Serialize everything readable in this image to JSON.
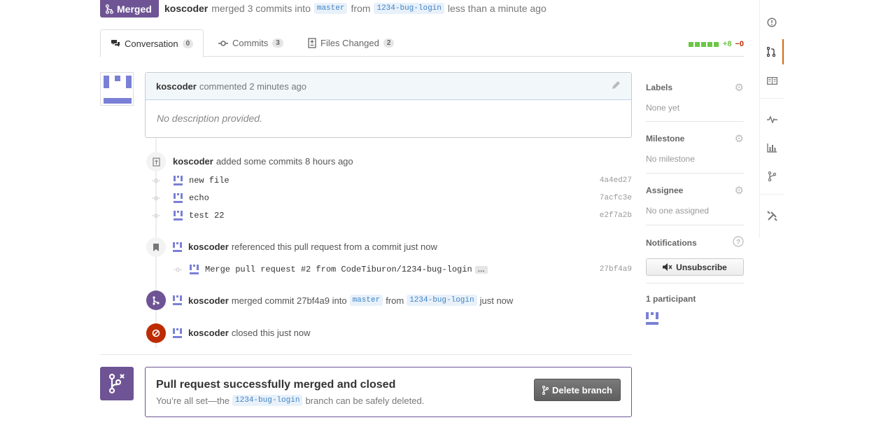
{
  "header": {
    "state_label": "Merged",
    "author": "koscoder",
    "merged_text": "merged 3 commits into",
    "base_branch": "master",
    "from_text": "from",
    "head_branch": "1234-bug-login",
    "time_text": "less than a minute ago"
  },
  "tabs": [
    {
      "label": "Conversation",
      "count": "0",
      "icon": "comment-icon"
    },
    {
      "label": "Commits",
      "count": "3",
      "icon": "commit-icon"
    },
    {
      "label": "Files Changed",
      "count": "2",
      "icon": "diff-icon"
    }
  ],
  "diffstat": {
    "additions": "+8",
    "deletions": "−0",
    "accent_color": "#6cc644",
    "deletion_color": "#bd2c00"
  },
  "comment": {
    "author": "koscoder",
    "action": "commented 2 minutes ago",
    "body": "No description provided."
  },
  "commits_event": {
    "author": "koscoder",
    "action": "added some commits 8 hours ago",
    "commits": [
      {
        "message": "new file",
        "sha": "4a4ed27"
      },
      {
        "message": "echo",
        "sha": "7acfc3e"
      },
      {
        "message": "test 22",
        "sha": "e2f7a2b"
      }
    ]
  },
  "reference_event": {
    "author": "koscoder",
    "action": "referenced this pull request from a commit just now",
    "commit_message": "Merge pull request #2 from CodeTiburon/1234-bug-login",
    "ellipsis": "…",
    "sha": "27bf4a9"
  },
  "merge_event": {
    "author": "koscoder",
    "action": "merged commit 27bf4a9 into",
    "base_branch": "master",
    "from_text": "from",
    "head_branch": "1234-bug-login",
    "time_text": "just now"
  },
  "close_event": {
    "author": "koscoder",
    "action": "closed this just now"
  },
  "merged_box": {
    "title": "Pull request successfully merged and closed",
    "text_before": "You’re all set—the",
    "branch": "1234-bug-login",
    "text_after": "branch can be safely deleted.",
    "button_label": "Delete branch",
    "color": "#6e5494"
  },
  "sidebar": {
    "labels": {
      "title": "Labels",
      "value": "None yet"
    },
    "milestone": {
      "title": "Milestone",
      "value": "No milestone"
    },
    "assignee": {
      "title": "Assignee",
      "value": "No one assigned"
    },
    "notifications": {
      "title": "Notifications",
      "button_label": "Unsubscribe"
    },
    "participants": {
      "title": "1 participant"
    }
  },
  "repo_nav": [
    "issues-icon",
    "pull-request-icon",
    "wiki-icon",
    "pulse-icon",
    "graphs-icon",
    "network-icon",
    "settings-icon"
  ]
}
